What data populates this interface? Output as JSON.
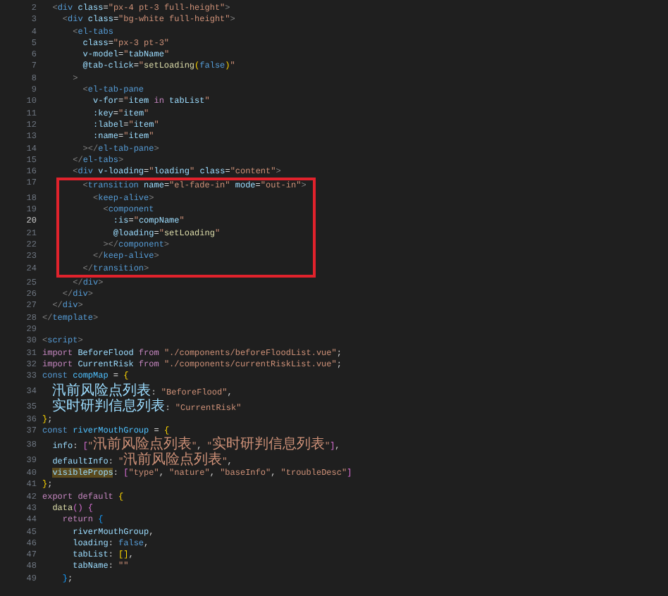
{
  "editor": {
    "lines": [
      {
        "number": "2",
        "current": false,
        "boxed": false,
        "tokens": [
          {
            "kind": "punct",
            "text": "  <"
          },
          {
            "kind": "tag",
            "text": "div"
          },
          {
            "kind": "attr",
            "text": " class"
          },
          {
            "kind": "txt",
            "text": "="
          },
          {
            "kind": "str",
            "text": "\"px-4 pt-3 full-height\""
          },
          {
            "kind": "punct",
            "text": ">"
          }
        ]
      },
      {
        "number": "3",
        "current": false,
        "boxed": false,
        "tokens": [
          {
            "kind": "punct",
            "text": "    <"
          },
          {
            "kind": "tag",
            "text": "div"
          },
          {
            "kind": "attr",
            "text": " class"
          },
          {
            "kind": "txt",
            "text": "="
          },
          {
            "kind": "str",
            "text": "\"bg-white full-height\""
          },
          {
            "kind": "punct",
            "text": ">"
          }
        ]
      },
      {
        "number": "4",
        "current": false,
        "boxed": false,
        "tokens": [
          {
            "kind": "punct",
            "text": "      <"
          },
          {
            "kind": "tag",
            "text": "el-tabs"
          }
        ]
      },
      {
        "number": "5",
        "current": false,
        "boxed": false,
        "tokens": [
          {
            "kind": "attr",
            "text": "        class"
          },
          {
            "kind": "txt",
            "text": "="
          },
          {
            "kind": "str",
            "text": "\"px-3 pt-3\""
          }
        ]
      },
      {
        "number": "6",
        "current": false,
        "boxed": false,
        "tokens": [
          {
            "kind": "attr",
            "text": "        v-model"
          },
          {
            "kind": "txt",
            "text": "="
          },
          {
            "kind": "str",
            "text": "\""
          },
          {
            "kind": "prop",
            "text": "tabName"
          },
          {
            "kind": "str",
            "text": "\""
          }
        ]
      },
      {
        "number": "7",
        "current": false,
        "boxed": false,
        "tokens": [
          {
            "kind": "attr",
            "text": "        @tab-click"
          },
          {
            "kind": "txt",
            "text": "="
          },
          {
            "kind": "str",
            "text": "\""
          },
          {
            "kind": "fn",
            "text": "setLoading"
          },
          {
            "kind": "br1",
            "text": "("
          },
          {
            "kind": "stor",
            "text": "false"
          },
          {
            "kind": "br1",
            "text": ")"
          },
          {
            "kind": "str",
            "text": "\""
          }
        ]
      },
      {
        "number": "8",
        "current": false,
        "boxed": false,
        "tokens": [
          {
            "kind": "punct",
            "text": "      >"
          }
        ]
      },
      {
        "number": "9",
        "current": false,
        "boxed": false,
        "tokens": [
          {
            "kind": "punct",
            "text": "        <"
          },
          {
            "kind": "tag",
            "text": "el-tab-pane"
          }
        ]
      },
      {
        "number": "10",
        "current": false,
        "boxed": false,
        "tokens": [
          {
            "kind": "attr",
            "text": "          v-for"
          },
          {
            "kind": "txt",
            "text": "="
          },
          {
            "kind": "str",
            "text": "\""
          },
          {
            "kind": "prop",
            "text": "item"
          },
          {
            "kind": "kw",
            "text": " in "
          },
          {
            "kind": "prop",
            "text": "tabList"
          },
          {
            "kind": "str",
            "text": "\""
          }
        ]
      },
      {
        "number": "11",
        "current": false,
        "boxed": false,
        "tokens": [
          {
            "kind": "attr",
            "text": "          :key"
          },
          {
            "kind": "txt",
            "text": "="
          },
          {
            "kind": "str",
            "text": "\""
          },
          {
            "kind": "prop",
            "text": "item"
          },
          {
            "kind": "str",
            "text": "\""
          }
        ]
      },
      {
        "number": "12",
        "current": false,
        "boxed": false,
        "tokens": [
          {
            "kind": "attr",
            "text": "          :label"
          },
          {
            "kind": "txt",
            "text": "="
          },
          {
            "kind": "str",
            "text": "\""
          },
          {
            "kind": "prop",
            "text": "item"
          },
          {
            "kind": "str",
            "text": "\""
          }
        ]
      },
      {
        "number": "13",
        "current": false,
        "boxed": false,
        "tokens": [
          {
            "kind": "attr",
            "text": "          :name"
          },
          {
            "kind": "txt",
            "text": "="
          },
          {
            "kind": "str",
            "text": "\""
          },
          {
            "kind": "prop",
            "text": "item"
          },
          {
            "kind": "str",
            "text": "\""
          }
        ]
      },
      {
        "number": "14",
        "current": false,
        "boxed": false,
        "tokens": [
          {
            "kind": "punct",
            "text": "        ></"
          },
          {
            "kind": "tag",
            "text": "el-tab-pane"
          },
          {
            "kind": "punct",
            "text": ">"
          }
        ]
      },
      {
        "number": "15",
        "current": false,
        "boxed": false,
        "tokens": [
          {
            "kind": "punct",
            "text": "      </"
          },
          {
            "kind": "tag",
            "text": "el-tabs"
          },
          {
            "kind": "punct",
            "text": ">"
          }
        ]
      },
      {
        "number": "16",
        "current": false,
        "boxed": false,
        "tokens": [
          {
            "kind": "punct",
            "text": "      <"
          },
          {
            "kind": "tag",
            "text": "div"
          },
          {
            "kind": "attr",
            "text": " v-loading"
          },
          {
            "kind": "txt",
            "text": "="
          },
          {
            "kind": "str",
            "text": "\""
          },
          {
            "kind": "prop",
            "text": "loading"
          },
          {
            "kind": "str",
            "text": "\""
          },
          {
            "kind": "attr",
            "text": " class"
          },
          {
            "kind": "txt",
            "text": "="
          },
          {
            "kind": "str",
            "text": "\"content\""
          },
          {
            "kind": "punct",
            "text": ">"
          }
        ]
      },
      {
        "number": "17",
        "current": false,
        "boxed": true,
        "tokens": [
          {
            "kind": "punct",
            "text": "        <"
          },
          {
            "kind": "tag",
            "text": "transition"
          },
          {
            "kind": "attr",
            "text": " name"
          },
          {
            "kind": "txt",
            "text": "="
          },
          {
            "kind": "str",
            "text": "\"el-fade-in\""
          },
          {
            "kind": "attr",
            "text": " mode"
          },
          {
            "kind": "txt",
            "text": "="
          },
          {
            "kind": "str",
            "text": "\"out-in\""
          },
          {
            "kind": "punct",
            "text": ">"
          }
        ]
      },
      {
        "number": "18",
        "current": false,
        "boxed": true,
        "tokens": [
          {
            "kind": "punct",
            "text": "          <"
          },
          {
            "kind": "tag",
            "text": "keep-alive"
          },
          {
            "kind": "punct",
            "text": ">"
          }
        ]
      },
      {
        "number": "19",
        "current": false,
        "boxed": true,
        "tokens": [
          {
            "kind": "punct",
            "text": "            <"
          },
          {
            "kind": "tag",
            "text": "component"
          }
        ]
      },
      {
        "number": "20",
        "current": true,
        "boxed": true,
        "tokens": [
          {
            "kind": "attr",
            "text": "              :is"
          },
          {
            "kind": "txt",
            "text": "="
          },
          {
            "kind": "str",
            "text": "\""
          },
          {
            "kind": "prop",
            "text": "compName"
          },
          {
            "kind": "str",
            "text": "\""
          }
        ]
      },
      {
        "number": "21",
        "current": false,
        "boxed": true,
        "tokens": [
          {
            "kind": "attr",
            "text": "              @loading"
          },
          {
            "kind": "txt",
            "text": "="
          },
          {
            "kind": "str",
            "text": "\""
          },
          {
            "kind": "fn",
            "text": "setLoading"
          },
          {
            "kind": "str",
            "text": "\""
          }
        ]
      },
      {
        "number": "22",
        "current": false,
        "boxed": true,
        "tokens": [
          {
            "kind": "punct",
            "text": "            ></"
          },
          {
            "kind": "tag",
            "text": "component"
          },
          {
            "kind": "punct",
            "text": ">"
          }
        ]
      },
      {
        "number": "23",
        "current": false,
        "boxed": true,
        "tokens": [
          {
            "kind": "punct",
            "text": "          </"
          },
          {
            "kind": "tag",
            "text": "keep-alive"
          },
          {
            "kind": "punct",
            "text": ">"
          }
        ]
      },
      {
        "number": "24",
        "current": false,
        "boxed": true,
        "tokens": [
          {
            "kind": "punct",
            "text": "        </"
          },
          {
            "kind": "tag",
            "text": "transition"
          },
          {
            "kind": "punct",
            "text": ">"
          }
        ]
      },
      {
        "number": "25",
        "current": false,
        "boxed": false,
        "tokens": [
          {
            "kind": "punct",
            "text": "      </"
          },
          {
            "kind": "tag",
            "text": "div"
          },
          {
            "kind": "punct",
            "text": ">"
          }
        ]
      },
      {
        "number": "26",
        "current": false,
        "boxed": false,
        "tokens": [
          {
            "kind": "punct",
            "text": "    </"
          },
          {
            "kind": "tag",
            "text": "div"
          },
          {
            "kind": "punct",
            "text": ">"
          }
        ]
      },
      {
        "number": "27",
        "current": false,
        "boxed": false,
        "tokens": [
          {
            "kind": "punct",
            "text": "  </"
          },
          {
            "kind": "tag",
            "text": "div"
          },
          {
            "kind": "punct",
            "text": ">"
          }
        ]
      },
      {
        "number": "28",
        "current": false,
        "boxed": false,
        "tokens": [
          {
            "kind": "punct",
            "text": "</"
          },
          {
            "kind": "tag",
            "text": "template"
          },
          {
            "kind": "punct",
            "text": ">"
          }
        ]
      },
      {
        "number": "29",
        "current": false,
        "boxed": false
      },
      {
        "number": "30",
        "current": false,
        "boxed": false,
        "tokens": [
          {
            "kind": "punct",
            "text": "<"
          },
          {
            "kind": "tag",
            "text": "script"
          },
          {
            "kind": "punct",
            "text": ">"
          }
        ]
      },
      {
        "number": "31",
        "current": false,
        "boxed": false,
        "tokens": [
          {
            "kind": "kw",
            "text": "import"
          },
          {
            "kind": "prop",
            "text": " BeforeFlood"
          },
          {
            "kind": "kw",
            "text": " from "
          },
          {
            "kind": "str",
            "text": "\"./components/beforeFloodList.vue\""
          },
          {
            "kind": "txt",
            "text": ";"
          }
        ]
      },
      {
        "number": "32",
        "current": false,
        "boxed": false,
        "tokens": [
          {
            "kind": "kw",
            "text": "import"
          },
          {
            "kind": "prop",
            "text": " CurrentRisk"
          },
          {
            "kind": "kw",
            "text": " from "
          },
          {
            "kind": "str",
            "text": "\"./components/currentRiskList.vue\""
          },
          {
            "kind": "txt",
            "text": ";"
          }
        ]
      },
      {
        "number": "33",
        "current": false,
        "boxed": false,
        "tokens": [
          {
            "kind": "stor",
            "text": "const"
          },
          {
            "kind": "var",
            "text": " compMap"
          },
          {
            "kind": "txt",
            "text": " = "
          },
          {
            "kind": "br1",
            "text": "{"
          }
        ]
      },
      {
        "number": "34",
        "current": false,
        "boxed": false,
        "tokens": [
          {
            "kind": "prop",
            "text": "  汛前风险点列表"
          },
          {
            "kind": "txt",
            "text": ": "
          },
          {
            "kind": "str",
            "text": "\"BeforeFlood\""
          },
          {
            "kind": "txt",
            "text": ","
          }
        ]
      },
      {
        "number": "35",
        "current": false,
        "boxed": false,
        "tokens": [
          {
            "kind": "prop",
            "text": "  实时研判信息列表"
          },
          {
            "kind": "txt",
            "text": ": "
          },
          {
            "kind": "str",
            "text": "\"CurrentRisk\""
          }
        ]
      },
      {
        "number": "36",
        "current": false,
        "boxed": false,
        "tokens": [
          {
            "kind": "br1",
            "text": "}"
          },
          {
            "kind": "txt",
            "text": ";"
          }
        ]
      },
      {
        "number": "37",
        "current": false,
        "boxed": false,
        "tokens": [
          {
            "kind": "stor",
            "text": "const"
          },
          {
            "kind": "var",
            "text": " riverMouthGroup"
          },
          {
            "kind": "txt",
            "text": " = "
          },
          {
            "kind": "br1",
            "text": "{"
          }
        ]
      },
      {
        "number": "38",
        "current": false,
        "boxed": false,
        "tokens": [
          {
            "kind": "prop",
            "text": "  info"
          },
          {
            "kind": "txt",
            "text": ": "
          },
          {
            "kind": "br2",
            "text": "["
          },
          {
            "kind": "str",
            "text": "\"汛前风险点列表\""
          },
          {
            "kind": "txt",
            "text": ", "
          },
          {
            "kind": "str",
            "text": "\"实时研判信息列表\""
          },
          {
            "kind": "br2",
            "text": "]"
          },
          {
            "kind": "txt",
            "text": ","
          }
        ]
      },
      {
        "number": "39",
        "current": false,
        "boxed": false,
        "tokens": [
          {
            "kind": "prop",
            "text": "  defaultInfo"
          },
          {
            "kind": "txt",
            "text": ": "
          },
          {
            "kind": "str",
            "text": "\"汛前风险点列表\""
          },
          {
            "kind": "txt",
            "text": ","
          }
        ]
      },
      {
        "number": "40",
        "current": false,
        "boxed": false,
        "tokens": [
          {
            "kind": "match",
            "text": "  visibleProps"
          },
          {
            "kind": "txt",
            "text": ": "
          },
          {
            "kind": "br2",
            "text": "["
          },
          {
            "kind": "str",
            "text": "\"type\""
          },
          {
            "kind": "txt",
            "text": ", "
          },
          {
            "kind": "str",
            "text": "\"nature\""
          },
          {
            "kind": "txt",
            "text": ", "
          },
          {
            "kind": "str",
            "text": "\"baseInfo\""
          },
          {
            "kind": "txt",
            "text": ", "
          },
          {
            "kind": "str",
            "text": "\"troubleDesc\""
          },
          {
            "kind": "br2",
            "text": "]"
          }
        ]
      },
      {
        "number": "41",
        "current": false,
        "boxed": false,
        "tokens": [
          {
            "kind": "br1",
            "text": "}"
          },
          {
            "kind": "txt",
            "text": ";"
          }
        ]
      },
      {
        "number": "42",
        "current": false,
        "boxed": false,
        "tokens": [
          {
            "kind": "kw",
            "text": "export default"
          },
          {
            "kind": "br1",
            "text": " {"
          }
        ]
      },
      {
        "number": "43",
        "current": false,
        "boxed": false,
        "tokens": [
          {
            "kind": "fn",
            "text": "  data"
          },
          {
            "kind": "br2",
            "text": "()"
          },
          {
            "kind": "br2",
            "text": " {"
          }
        ]
      },
      {
        "number": "44",
        "current": false,
        "boxed": false,
        "tokens": [
          {
            "kind": "kw",
            "text": "    return"
          },
          {
            "kind": "br3",
            "text": " {"
          }
        ]
      },
      {
        "number": "45",
        "current": false,
        "boxed": false,
        "tokens": [
          {
            "kind": "prop",
            "text": "      riverMouthGroup"
          },
          {
            "kind": "txt",
            "text": ","
          }
        ]
      },
      {
        "number": "46",
        "current": false,
        "boxed": false,
        "tokens": [
          {
            "kind": "prop",
            "text": "      loading"
          },
          {
            "kind": "txt",
            "text": ": "
          },
          {
            "kind": "stor",
            "text": "false"
          },
          {
            "kind": "txt",
            "text": ","
          }
        ]
      },
      {
        "number": "47",
        "current": false,
        "boxed": false,
        "tokens": [
          {
            "kind": "prop",
            "text": "      tabList"
          },
          {
            "kind": "txt",
            "text": ": "
          },
          {
            "kind": "br1",
            "text": "[]"
          },
          {
            "kind": "txt",
            "text": ","
          }
        ]
      },
      {
        "number": "48",
        "current": false,
        "boxed": false,
        "tokens": [
          {
            "kind": "prop",
            "text": "      tabName"
          },
          {
            "kind": "txt",
            "text": ": "
          },
          {
            "kind": "str",
            "text": "\"\""
          }
        ]
      },
      {
        "number": "49",
        "current": false,
        "boxed": false,
        "tokens": [
          {
            "kind": "br3",
            "text": "    }"
          },
          {
            "kind": "txt",
            "text": ";"
          }
        ]
      }
    ]
  }
}
